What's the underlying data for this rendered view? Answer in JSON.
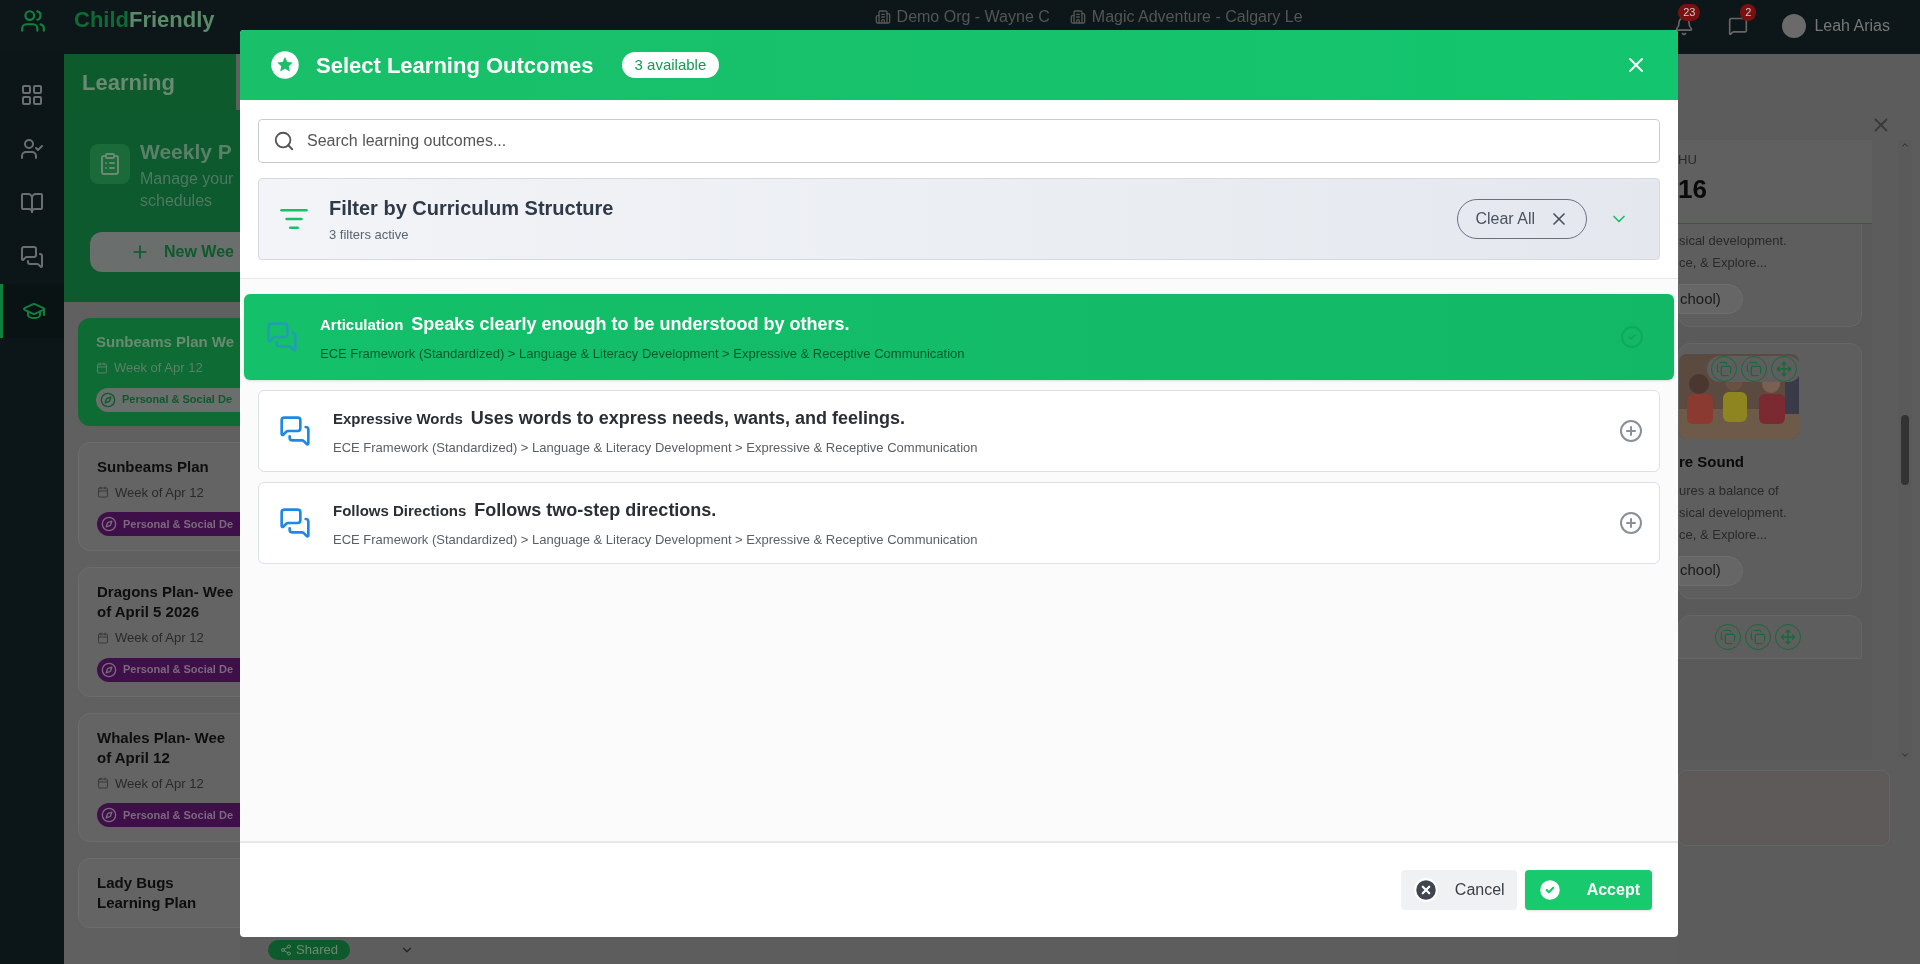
{
  "app": {
    "logo_first": "Child",
    "logo_second": "Friendly",
    "org": "Demo Org - Wayne C",
    "location": "Magic Adventure - Calgary Le",
    "notifications": "23",
    "messages": "2",
    "user": "Leah Arias"
  },
  "nav": [
    {
      "kind": "apps",
      "selected": false
    },
    {
      "kind": "attendance",
      "selected": false
    },
    {
      "kind": "library",
      "selected": false
    },
    {
      "kind": "chat",
      "selected": false
    },
    {
      "kind": "learning",
      "selected": true
    }
  ],
  "learning": {
    "tab": "Learning",
    "title": "Weekly P",
    "subtitle_lines": [
      "Manage your",
      "schedules"
    ],
    "new_button": "New Wee"
  },
  "plans": [
    {
      "title_lines": [
        "Sunbeams Plan We"
      ],
      "week": "Week of Apr 12",
      "tag": "Personal & Social De",
      "selected": true
    },
    {
      "title_lines": [
        "Sunbeams Plan"
      ],
      "week": "Week of Apr 12",
      "tag": "Personal & Social De",
      "selected": false
    },
    {
      "title_lines": [
        "Dragons Plan- Wee",
        "of April 5 2026"
      ],
      "week": "Week of Apr 12",
      "tag": "Personal & Social De",
      "selected": false
    },
    {
      "title_lines": [
        "Whales Plan- Wee",
        "of April 12"
      ],
      "week": "Week of Apr 12",
      "tag": "Personal & Social De",
      "selected": false
    },
    {
      "title_lines": [
        "Lady Bugs",
        "Learning Plan"
      ],
      "selected": false
    }
  ],
  "shared_badge": "Shared",
  "day": {
    "weekday": "HU",
    "date": "16"
  },
  "day_cards": [
    {
      "kind": "text",
      "lines": [
        "sical development.",
        "ce, & Explore..."
      ],
      "tag": "chool)"
    },
    {
      "kind": "picture",
      "title": "re Sound",
      "lines": [
        "ures a balance of",
        "sical development.",
        "ce, & Explore..."
      ],
      "tag": "chool)"
    }
  ],
  "modal": {
    "title": "Select Learning Outcomes",
    "count": "3 available",
    "search": {
      "placeholder": "Search learning outcomes..."
    },
    "filter": {
      "title": "Filter by Curriculum Structure",
      "subtitle": "3 filters active",
      "clear": "Clear All"
    },
    "outcomes": [
      {
        "name": "Articulation",
        "description": "Speaks clearly enough to be understood by others.",
        "path": "ECE Framework (Standardized) > Language & Literacy Development > Expressive & Receptive Communication",
        "selected": true
      },
      {
        "name": "Expressive Words",
        "description": "Uses words to express needs, wants, and feelings.",
        "path": "ECE Framework (Standardized) > Language & Literacy Development > Expressive & Receptive Communication",
        "selected": false
      },
      {
        "name": "Follows Directions",
        "description": "Follows two-step directions.",
        "path": "ECE Framework (Standardized) > Language & Literacy Development > Expressive & Receptive Communication",
        "selected": false
      }
    ],
    "cancel": "Cancel",
    "accept": "Accept"
  }
}
